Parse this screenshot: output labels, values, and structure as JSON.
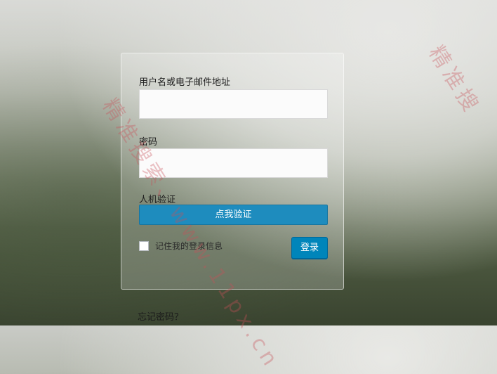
{
  "form": {
    "username_label": "用户名或电子邮件地址",
    "username_value": "",
    "password_label": "密码",
    "password_value": "",
    "captcha_label": "人机验证",
    "captcha_button": "点我验证",
    "remember_label": "记住我的登录信息",
    "remember_checked": false,
    "login_button": "登录"
  },
  "links": {
    "forgot_password": "忘记密码？"
  },
  "watermark": {
    "text_main": "精准搜索、www.11px.cn",
    "text_corner": "精准搜"
  },
  "colors": {
    "button_blue": "#0085ba",
    "captcha_blue": "#1e8cbe"
  }
}
